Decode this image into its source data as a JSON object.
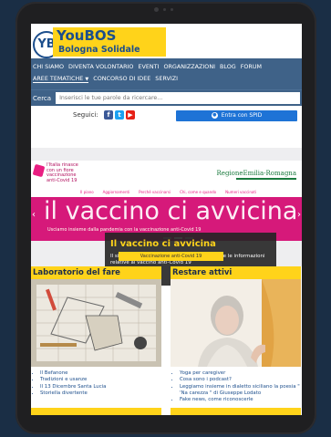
{
  "site": {
    "logo_mark": "YB",
    "brand_title": "YouBOS",
    "brand_subtitle": "Bologna Solidale"
  },
  "nav": {
    "row1": [
      "CHI SIAMO",
      "DIVENTA VOLONTARIO",
      "EVENTI",
      "ORGANIZZAZIONI",
      "BLOG",
      "FORUM"
    ],
    "row2": [
      "AREE TEMATICHE",
      "CONCORSO DI IDEE",
      "SERVIZI"
    ],
    "active_item": "AREE TEMATICHE"
  },
  "search": {
    "label": "Cerca",
    "placeholder": "Inserisci le tue parole da ricercare..."
  },
  "social": {
    "follow_label": "Seguici:",
    "spid_label": "Entra con SPID",
    "icons": [
      "facebook-icon",
      "twitter-icon",
      "youtube-icon"
    ]
  },
  "banner": {
    "ier_text": "l'Italia rinasce con un fiore vaccinazione anti-Covid 19",
    "regione": "RegioneEmilia-Romagna",
    "tabs": [
      "Il piano",
      "Aggiornamenti",
      "Perché vaccinarsi",
      "Chi, come e quando",
      "Numeri vaccinati"
    ],
    "big_text": "il vaccino ci avvicina",
    "small_text": "Usciamo insieme dalla pandemia con la vaccinazione anti-Covid 19",
    "overlay_title": "Il vaccino ci avvicina",
    "overlay_text": "Il sito della Regione Emilia-Romagna con tutte le informazioni relative al vaccino anti-Covid 19",
    "cta": "Vaccinazione anti-Covid 19",
    "slide_count": 3,
    "active_slide": 2
  },
  "cards": [
    {
      "title": "Laboratorio del fare",
      "items": [
        "Il Befanone",
        "Tradizioni e usanze",
        "Il 13 Dicembre Santa Lucia",
        "Storiella divertente"
      ]
    },
    {
      "title": "Restare attivi",
      "items": [
        "Yoga per caregiver",
        "Cosa sono i podcast?",
        "Leggiamo insieme in dialetto siciliano la poesia \" 'Na carezza \" di Giuseppe Lodato",
        "Fake news, come riconoscerle"
      ]
    }
  ],
  "colors": {
    "brand_yellow": "#ffd31a",
    "brand_blue": "#1c4e8c",
    "nav_bg": "#3f6288",
    "banner_pink": "#d6197a",
    "spid_blue": "#1e73d6"
  }
}
